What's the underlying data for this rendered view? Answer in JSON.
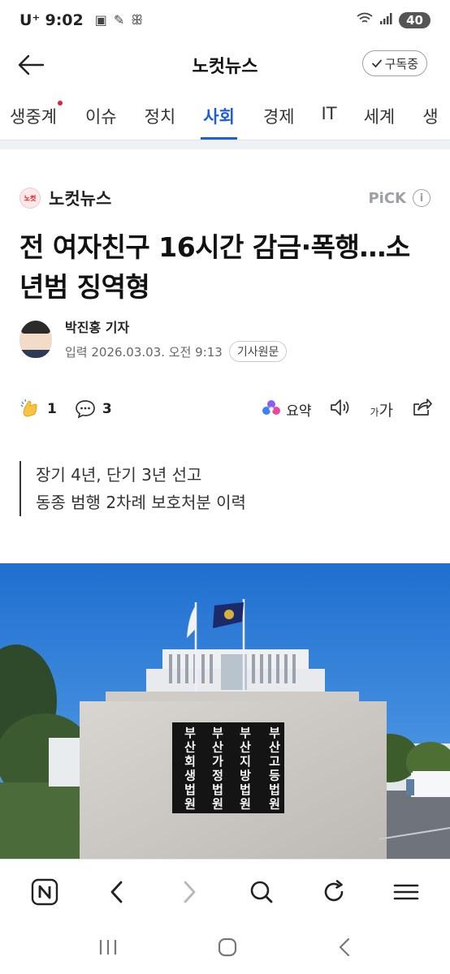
{
  "status_bar": {
    "carrier": "U⁺",
    "time": "9:02",
    "battery": "40"
  },
  "header": {
    "title": "노컷뉴스",
    "subscribe_label": "구독중"
  },
  "tabs": [
    {
      "label": "생중계"
    },
    {
      "label": "이슈"
    },
    {
      "label": "정치"
    },
    {
      "label": "사회"
    },
    {
      "label": "경제"
    },
    {
      "label": "IT"
    },
    {
      "label": "세계"
    },
    {
      "label": "생"
    }
  ],
  "article": {
    "publisher": "노컷뉴스",
    "publisher_logo_text": "노컷",
    "pick_label": "PiCK",
    "headline": "전 여자친구 16시간 감금·폭행…소년범 징역형",
    "reporter": "박진홍 기자",
    "date": "입력 2026.03.03. 오전 9:13",
    "original_label": "기사원문",
    "summary": [
      "장기 4년, 단기 3년 선고",
      "동종 범행 2차례 보호처분 이력"
    ]
  },
  "actions": {
    "like_count": "1",
    "comment_count": "3",
    "summary_label": "요약",
    "font_label_small": "가",
    "font_label_big": "가"
  },
  "photo": {
    "signs": [
      "부산고등법원",
      "부산지방법원",
      "부산가정법원",
      "부산회생법원"
    ]
  },
  "colors": {
    "accent": "#1f5fd6",
    "new_dot": "#e0203a",
    "sky": "#2f7fd8"
  }
}
